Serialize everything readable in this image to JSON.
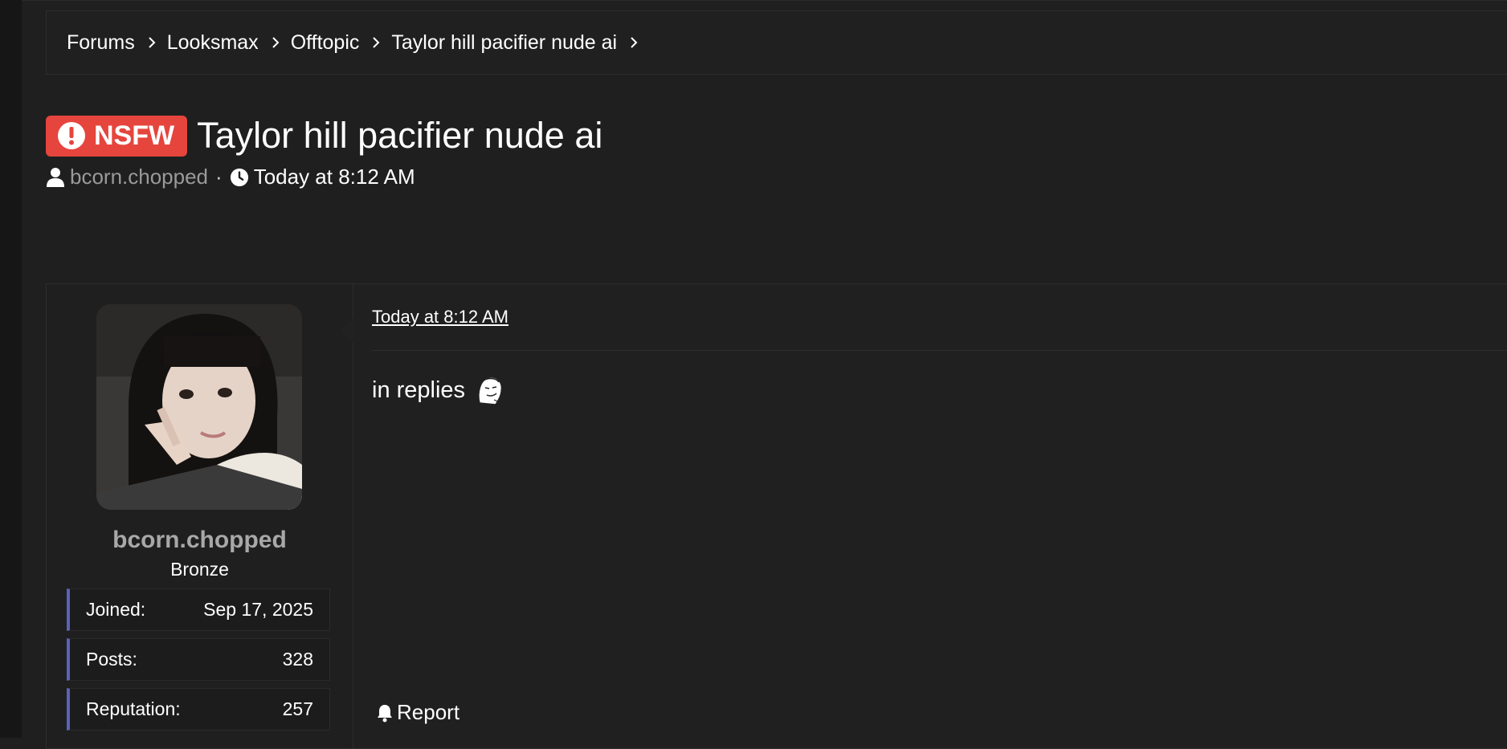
{
  "breadcrumb": [
    "Forums",
    "Looksmax",
    "Offtopic",
    "Taylor hill pacifier nude ai"
  ],
  "thread": {
    "badge": "NSFW",
    "title": "Taylor hill pacifier nude ai",
    "author": "bcorn.chopped",
    "separator": "·",
    "time": "Today at 8:12 AM"
  },
  "post": {
    "date": "Today at 8:12 AM",
    "body": "in replies",
    "report_label": "Report",
    "user": {
      "name": "bcorn.chopped",
      "rank": "Bronze",
      "stats": [
        {
          "label": "Joined:",
          "value": "Sep 17, 2025"
        },
        {
          "label": "Posts:",
          "value": "328"
        },
        {
          "label": "Reputation:",
          "value": "257"
        }
      ]
    }
  },
  "colors": {
    "background": "#1f1f1f",
    "nsfw_badge": "#e5453d",
    "stat_accent": "#5a63b8",
    "muted_text": "#9a9a9a"
  }
}
